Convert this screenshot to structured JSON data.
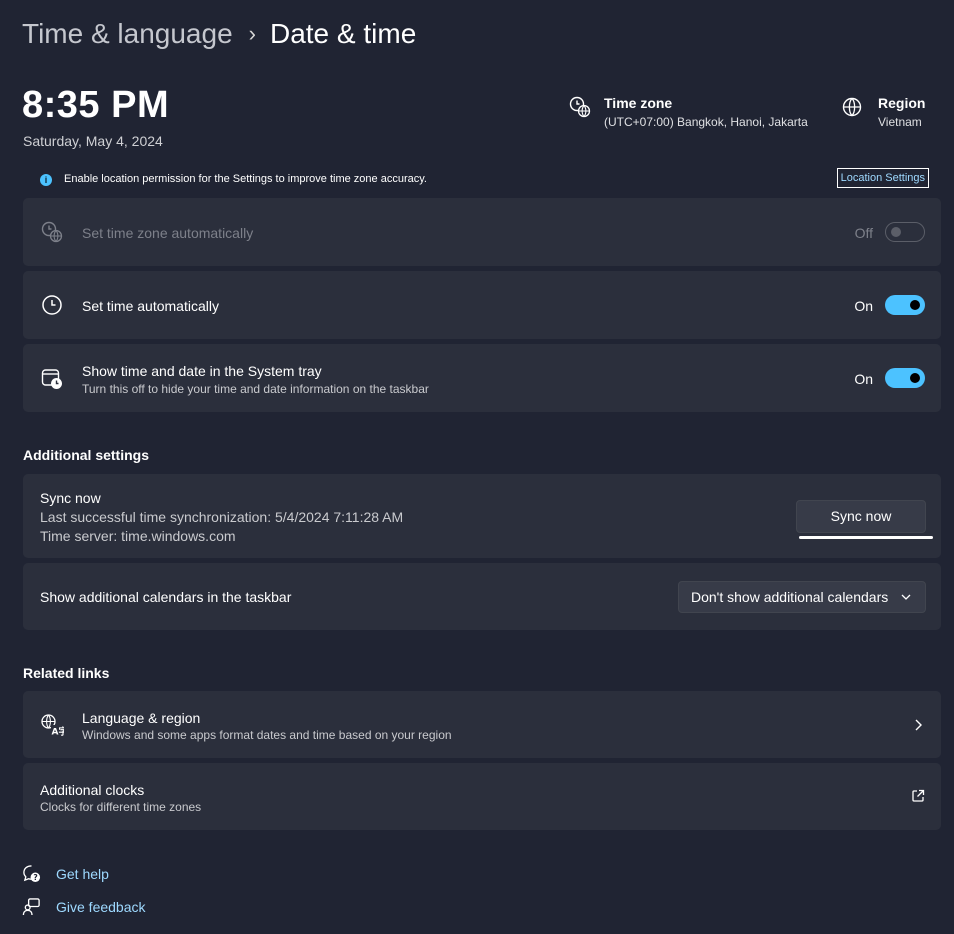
{
  "breadcrumb": {
    "parent": "Time & language",
    "separator": "›",
    "current": "Date & time"
  },
  "clock": {
    "time": "8:35 PM",
    "date": "Saturday, May 4, 2024"
  },
  "time_zone": {
    "title": "Time zone",
    "value": "(UTC+07:00) Bangkok, Hanoi, Jakarta",
    "icon": "time-zone-icon"
  },
  "region": {
    "title": "Region",
    "value": "Vietnam",
    "icon": "globe-icon"
  },
  "banner": {
    "text": "Enable location permission for the Settings to improve time zone accuracy.",
    "link": "Location Settings",
    "icon": "info-icon"
  },
  "settings": {
    "tz_auto": {
      "label": "Set time zone automatically",
      "state": "Off"
    },
    "time_auto": {
      "label": "Set time automatically",
      "state": "On"
    },
    "tray": {
      "label": "Show time and date in the System tray",
      "desc": "Turn this off to hide your time and date information on the taskbar",
      "state": "On"
    }
  },
  "additional": {
    "heading": "Additional settings",
    "sync": {
      "title": "Sync now",
      "last": "Last successful time synchronization: 5/4/2024 7:11:28 AM",
      "server": "Time server: time.windows.com",
      "button": "Sync now"
    },
    "calendars": {
      "label": "Show additional calendars in the taskbar",
      "selected": "Don't show additional calendars"
    }
  },
  "related": {
    "heading": "Related links",
    "language": {
      "title": "Language & region",
      "desc": "Windows and some apps format dates and time based on your region"
    },
    "clocks": {
      "title": "Additional clocks",
      "desc": "Clocks for different time zones"
    }
  },
  "footer": {
    "help": "Get help",
    "feedback": "Give feedback"
  },
  "colors": {
    "background": "#202433",
    "card": "#2b2f3c",
    "accent": "#4cc2ff",
    "link": "#9ed9ff"
  }
}
